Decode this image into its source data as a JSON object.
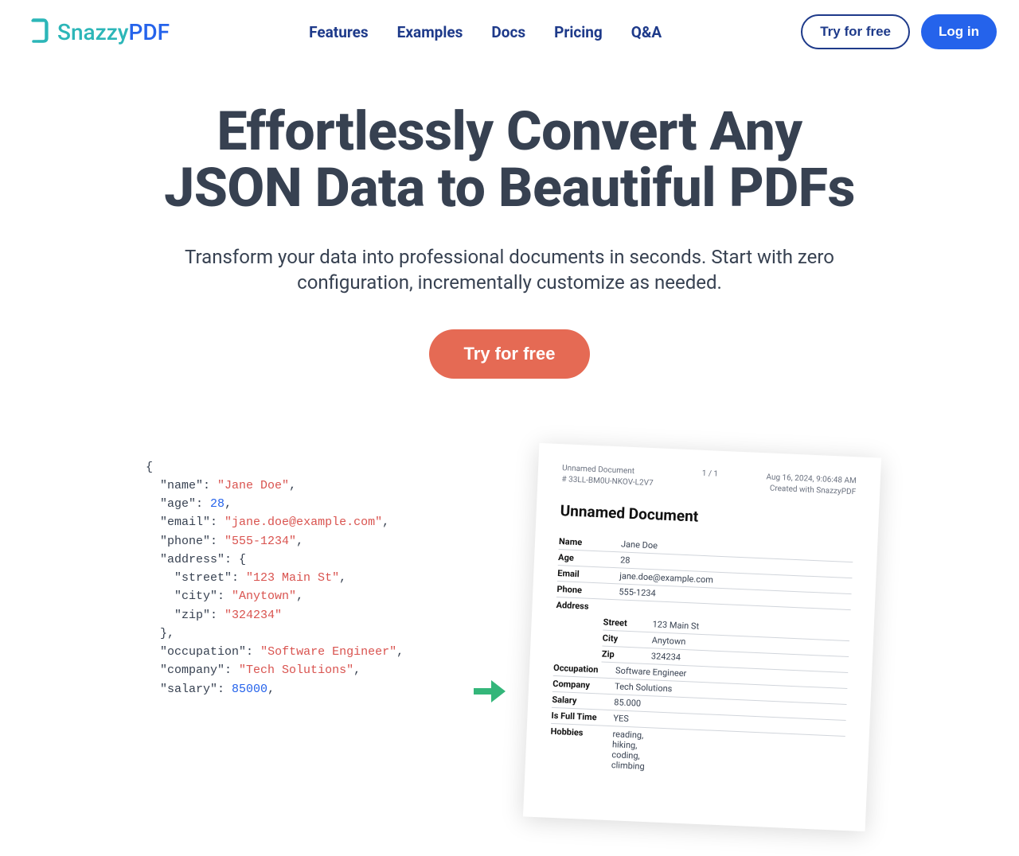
{
  "logo": {
    "part1": "Snazzy",
    "part2": "PDF"
  },
  "nav": {
    "features": "Features",
    "examples": "Examples",
    "docs": "Docs",
    "pricing": "Pricing",
    "qa": "Q&A"
  },
  "header_buttons": {
    "try": "Try for free",
    "login": "Log in"
  },
  "hero": {
    "title": "Effortlessly Convert Any JSON Data to Beautiful PDFs",
    "subtitle": "Transform your data into professional documents in seconds. Start with zero configuration, incrementally customize as needed.",
    "cta": "Try for free"
  },
  "code": {
    "name_k": "\"name\"",
    "name_v": "\"Jane Doe\"",
    "age_k": "\"age\"",
    "age_v": "28",
    "email_k": "\"email\"",
    "email_v": "\"jane.doe@example.com\"",
    "phone_k": "\"phone\"",
    "phone_v": "\"555-1234\"",
    "address_k": "\"address\"",
    "street_k": "\"street\"",
    "street_v": "\"123 Main St\"",
    "city_k": "\"city\"",
    "city_v": "\"Anytown\"",
    "zip_k": "\"zip\"",
    "zip_v": "\"324234\"",
    "occupation_k": "\"occupation\"",
    "occupation_v": "\"Software Engineer\"",
    "company_k": "\"company\"",
    "company_v": "\"Tech Solutions\"",
    "salary_k": "\"salary\"",
    "salary_v": "85000"
  },
  "pdf": {
    "doc_name": "Unnamed Document",
    "doc_sub": "# 33LL-BM0U-NKOV-L2V7",
    "pages": "1 / 1",
    "timestamp": "Aug 16, 2024, 9:06:48 AM",
    "created": "Created with SnazzyPDF",
    "title": "Unnamed Document",
    "rows": {
      "name_l": "Name",
      "name_v": "Jane Doe",
      "age_l": "Age",
      "age_v": "28",
      "email_l": "Email",
      "email_v": "jane.doe@example.com",
      "phone_l": "Phone",
      "phone_v": "555-1234",
      "address_l": "Address",
      "street_l": "Street",
      "street_v": "123 Main St",
      "city_l": "City",
      "city_v": "Anytown",
      "zip_l": "Zip",
      "zip_v": "324234",
      "occupation_l": "Occupation",
      "occupation_v": "Software Engineer",
      "company_l": "Company",
      "company_v": "Tech Solutions",
      "salary_l": "Salary",
      "salary_v": "85.000",
      "fulltime_l": "Is Full Time",
      "fulltime_v": "YES",
      "hobbies_l": "Hobbies",
      "hobbies_v": "reading,\nhiking,\ncoding,\nclimbing"
    }
  }
}
